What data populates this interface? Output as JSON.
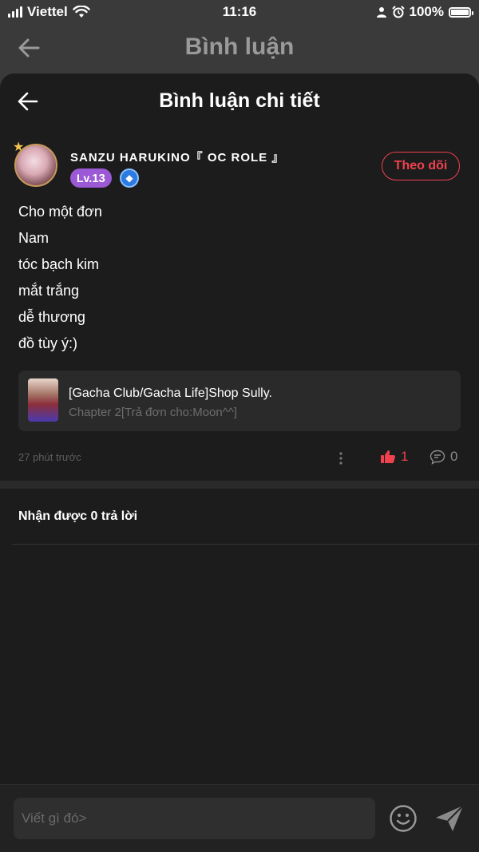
{
  "status_bar": {
    "carrier": "Viettel",
    "time": "11:16",
    "battery": "100%",
    "battery_level": 1.0
  },
  "top_nav": {
    "title": "Bình luận"
  },
  "sheet": {
    "title": "Bình luận chi tiết"
  },
  "comment": {
    "username": "SANZU HARUKINO『 OC ROLE 』",
    "level_prefix": "Lv.",
    "level_value": "13",
    "follow_label": "Theo dõi",
    "lines": [
      "Cho một đơn",
      "Nam",
      "tóc bạch kim",
      "mắt trắng",
      "dễ thương",
      "đồ tùy ý:)"
    ],
    "attachment": {
      "title": "[Gacha Club/Gacha Life]Shop Sully.",
      "subtitle": "Chapter 2[Trả đơn cho:Moon^^]"
    },
    "timestamp": "27 phút trước",
    "like_count": "1",
    "reply_count": "0"
  },
  "replies": {
    "label": "Nhận được 0 trả lời"
  },
  "composer": {
    "placeholder": "Viết gì đó>"
  },
  "colors": {
    "accent_red": "#f0414f",
    "level_purple": "#9b59d6",
    "badge_blue": "#2d7be0",
    "sheet_bg": "#1c1c1c"
  },
  "icons": [
    "signal-icon",
    "wifi-icon",
    "person-icon",
    "alarm-icon",
    "battery-icon",
    "back-arrow-icon",
    "crown-star-icon",
    "title-badge-icon",
    "more-vertical-icon",
    "thumbs-up-icon",
    "comment-bubble-icon",
    "emoji-icon",
    "send-icon"
  ]
}
